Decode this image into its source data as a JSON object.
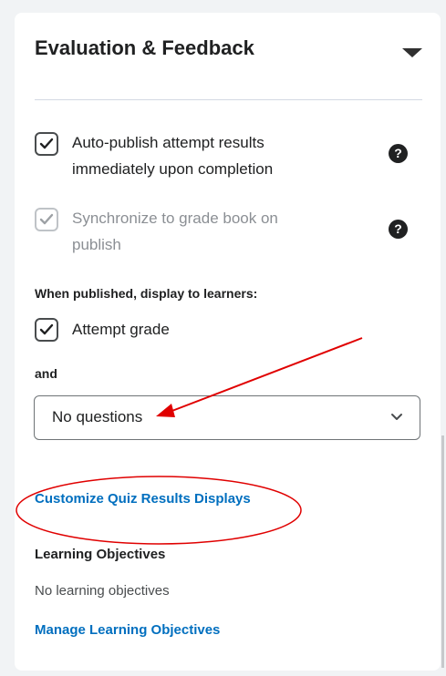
{
  "section": {
    "title": "Evaluation & Feedback"
  },
  "options": {
    "auto_publish_label": "Auto-publish attempt results immediately upon completion",
    "auto_publish_line1": "Auto-publish attempt results",
    "auto_publish_line2": "immediately upon completion",
    "auto_publish_checked": true,
    "sync_label": "Synchronize to grade book on publish",
    "sync_line1": "Synchronize to grade book on",
    "sync_line2": "publish",
    "sync_checked": true,
    "sync_disabled": true
  },
  "display": {
    "heading": "When published, display to learners:",
    "attempt_grade_label": "Attempt grade",
    "attempt_grade_checked": true,
    "and_label": "and",
    "questions_select_value": "No questions"
  },
  "links": {
    "customize": "Customize Quiz Results Displays",
    "manage_objectives": "Manage Learning Objectives"
  },
  "objectives": {
    "heading": "Learning Objectives",
    "empty_text": "No learning objectives"
  },
  "icons": {
    "help": "help-icon",
    "check": "checkmark-icon",
    "caret": "caret-down-icon",
    "chevron": "chevron-down-icon"
  },
  "colors": {
    "link": "#006fbf",
    "annotation": "#e00000"
  }
}
